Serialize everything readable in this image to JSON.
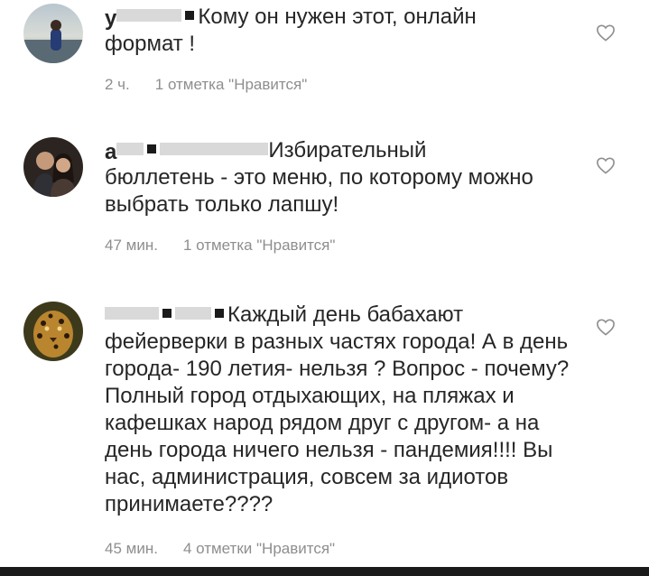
{
  "comments": [
    {
      "username": "у",
      "text_first": "Кому он  нужен этот, онлайн",
      "text_rest": "формат !",
      "time": "2 ч.",
      "likes": "1 отметка \"Нравится\""
    },
    {
      "username": "а",
      "text_first": "Избирательный",
      "text_rest": "бюллетень - это меню, по которому можно выбрать только лапшу!",
      "time": "47 мин.",
      "likes": "1 отметка \"Нравится\""
    },
    {
      "username": "",
      "text_first": "Каждый день бабахают",
      "text_rest": "фейерверки в разных частях города! А в день города- 190 летия- нельзя ? Вопрос - почему? Полный город отдыхающих, на пляжах и кафешках народ рядом друг с другом- а на день города ничего нельзя - пандемия!!!! Вы нас, администрация, совсем за идиотов принимаете????",
      "time": "45 мин.",
      "likes": "4 отметки \"Нравится\""
    }
  ],
  "icons": {
    "like": "heart-outline-icon"
  },
  "colors": {
    "meta": "#8e8e8e",
    "text": "#262626"
  }
}
